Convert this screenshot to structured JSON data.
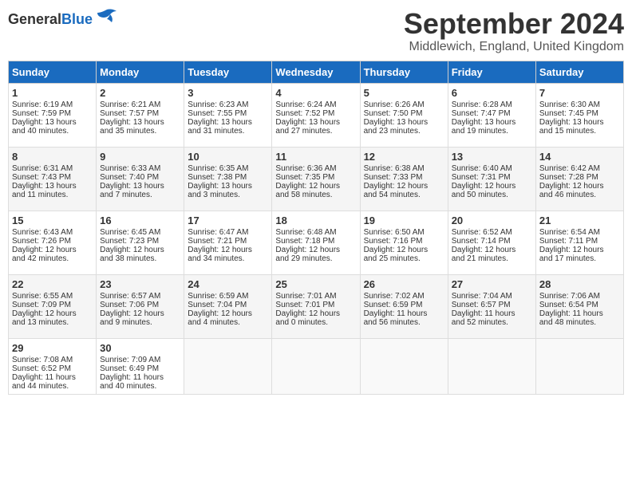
{
  "header": {
    "logo_general": "General",
    "logo_blue": "Blue",
    "month": "September 2024",
    "location": "Middlewich, England, United Kingdom"
  },
  "days_of_week": [
    "Sunday",
    "Monday",
    "Tuesday",
    "Wednesday",
    "Thursday",
    "Friday",
    "Saturday"
  ],
  "weeks": [
    [
      {
        "day": "1",
        "lines": [
          "Sunrise: 6:19 AM",
          "Sunset: 7:59 PM",
          "Daylight: 13 hours",
          "and 40 minutes."
        ]
      },
      {
        "day": "2",
        "lines": [
          "Sunrise: 6:21 AM",
          "Sunset: 7:57 PM",
          "Daylight: 13 hours",
          "and 35 minutes."
        ]
      },
      {
        "day": "3",
        "lines": [
          "Sunrise: 6:23 AM",
          "Sunset: 7:55 PM",
          "Daylight: 13 hours",
          "and 31 minutes."
        ]
      },
      {
        "day": "4",
        "lines": [
          "Sunrise: 6:24 AM",
          "Sunset: 7:52 PM",
          "Daylight: 13 hours",
          "and 27 minutes."
        ]
      },
      {
        "day": "5",
        "lines": [
          "Sunrise: 6:26 AM",
          "Sunset: 7:50 PM",
          "Daylight: 13 hours",
          "and 23 minutes."
        ]
      },
      {
        "day": "6",
        "lines": [
          "Sunrise: 6:28 AM",
          "Sunset: 7:47 PM",
          "Daylight: 13 hours",
          "and 19 minutes."
        ]
      },
      {
        "day": "7",
        "lines": [
          "Sunrise: 6:30 AM",
          "Sunset: 7:45 PM",
          "Daylight: 13 hours",
          "and 15 minutes."
        ]
      }
    ],
    [
      {
        "day": "8",
        "lines": [
          "Sunrise: 6:31 AM",
          "Sunset: 7:43 PM",
          "Daylight: 13 hours",
          "and 11 minutes."
        ]
      },
      {
        "day": "9",
        "lines": [
          "Sunrise: 6:33 AM",
          "Sunset: 7:40 PM",
          "Daylight: 13 hours",
          "and 7 minutes."
        ]
      },
      {
        "day": "10",
        "lines": [
          "Sunrise: 6:35 AM",
          "Sunset: 7:38 PM",
          "Daylight: 13 hours",
          "and 3 minutes."
        ]
      },
      {
        "day": "11",
        "lines": [
          "Sunrise: 6:36 AM",
          "Sunset: 7:35 PM",
          "Daylight: 12 hours",
          "and 58 minutes."
        ]
      },
      {
        "day": "12",
        "lines": [
          "Sunrise: 6:38 AM",
          "Sunset: 7:33 PM",
          "Daylight: 12 hours",
          "and 54 minutes."
        ]
      },
      {
        "day": "13",
        "lines": [
          "Sunrise: 6:40 AM",
          "Sunset: 7:31 PM",
          "Daylight: 12 hours",
          "and 50 minutes."
        ]
      },
      {
        "day": "14",
        "lines": [
          "Sunrise: 6:42 AM",
          "Sunset: 7:28 PM",
          "Daylight: 12 hours",
          "and 46 minutes."
        ]
      }
    ],
    [
      {
        "day": "15",
        "lines": [
          "Sunrise: 6:43 AM",
          "Sunset: 7:26 PM",
          "Daylight: 12 hours",
          "and 42 minutes."
        ]
      },
      {
        "day": "16",
        "lines": [
          "Sunrise: 6:45 AM",
          "Sunset: 7:23 PM",
          "Daylight: 12 hours",
          "and 38 minutes."
        ]
      },
      {
        "day": "17",
        "lines": [
          "Sunrise: 6:47 AM",
          "Sunset: 7:21 PM",
          "Daylight: 12 hours",
          "and 34 minutes."
        ]
      },
      {
        "day": "18",
        "lines": [
          "Sunrise: 6:48 AM",
          "Sunset: 7:18 PM",
          "Daylight: 12 hours",
          "and 29 minutes."
        ]
      },
      {
        "day": "19",
        "lines": [
          "Sunrise: 6:50 AM",
          "Sunset: 7:16 PM",
          "Daylight: 12 hours",
          "and 25 minutes."
        ]
      },
      {
        "day": "20",
        "lines": [
          "Sunrise: 6:52 AM",
          "Sunset: 7:14 PM",
          "Daylight: 12 hours",
          "and 21 minutes."
        ]
      },
      {
        "day": "21",
        "lines": [
          "Sunrise: 6:54 AM",
          "Sunset: 7:11 PM",
          "Daylight: 12 hours",
          "and 17 minutes."
        ]
      }
    ],
    [
      {
        "day": "22",
        "lines": [
          "Sunrise: 6:55 AM",
          "Sunset: 7:09 PM",
          "Daylight: 12 hours",
          "and 13 minutes."
        ]
      },
      {
        "day": "23",
        "lines": [
          "Sunrise: 6:57 AM",
          "Sunset: 7:06 PM",
          "Daylight: 12 hours",
          "and 9 minutes."
        ]
      },
      {
        "day": "24",
        "lines": [
          "Sunrise: 6:59 AM",
          "Sunset: 7:04 PM",
          "Daylight: 12 hours",
          "and 4 minutes."
        ]
      },
      {
        "day": "25",
        "lines": [
          "Sunrise: 7:01 AM",
          "Sunset: 7:01 PM",
          "Daylight: 12 hours",
          "and 0 minutes."
        ]
      },
      {
        "day": "26",
        "lines": [
          "Sunrise: 7:02 AM",
          "Sunset: 6:59 PM",
          "Daylight: 11 hours",
          "and 56 minutes."
        ]
      },
      {
        "day": "27",
        "lines": [
          "Sunrise: 7:04 AM",
          "Sunset: 6:57 PM",
          "Daylight: 11 hours",
          "and 52 minutes."
        ]
      },
      {
        "day": "28",
        "lines": [
          "Sunrise: 7:06 AM",
          "Sunset: 6:54 PM",
          "Daylight: 11 hours",
          "and 48 minutes."
        ]
      }
    ],
    [
      {
        "day": "29",
        "lines": [
          "Sunrise: 7:08 AM",
          "Sunset: 6:52 PM",
          "Daylight: 11 hours",
          "and 44 minutes."
        ]
      },
      {
        "day": "30",
        "lines": [
          "Sunrise: 7:09 AM",
          "Sunset: 6:49 PM",
          "Daylight: 11 hours",
          "and 40 minutes."
        ]
      },
      {
        "day": "",
        "lines": []
      },
      {
        "day": "",
        "lines": []
      },
      {
        "day": "",
        "lines": []
      },
      {
        "day": "",
        "lines": []
      },
      {
        "day": "",
        "lines": []
      }
    ]
  ]
}
